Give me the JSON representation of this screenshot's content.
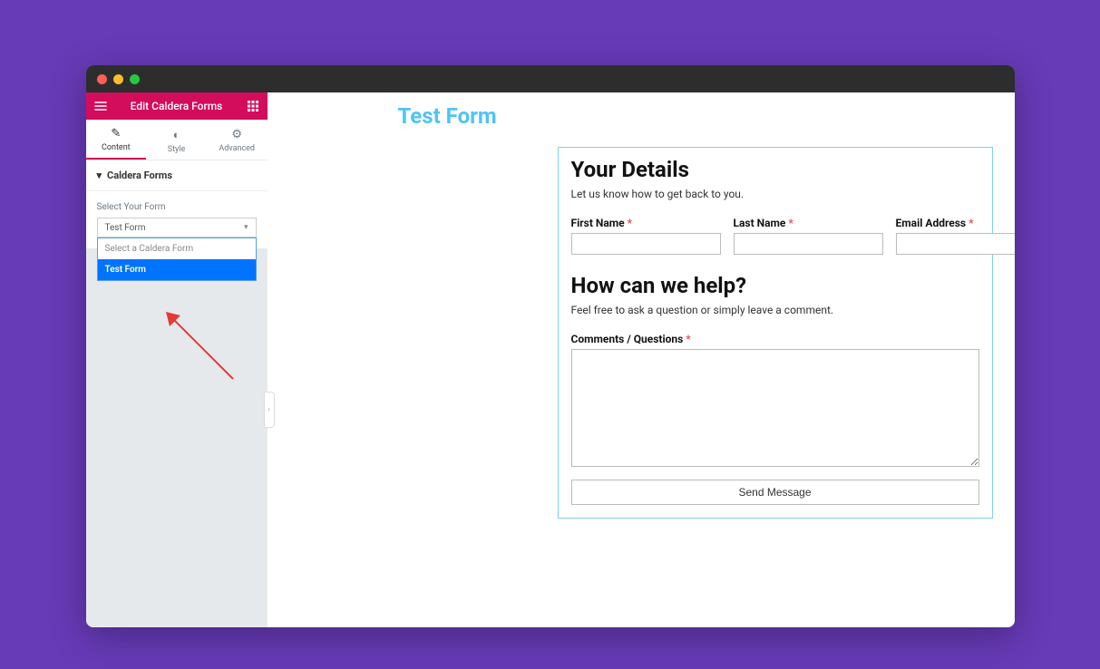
{
  "sidebar": {
    "header_title": "Edit Caldera Forms",
    "tabs": {
      "content": "Content",
      "style": "Style",
      "advanced": "Advanced"
    },
    "section_title": "Caldera Forms",
    "select_label": "Select Your Form",
    "select_current": "Test Form",
    "dropdown": {
      "placeholder": "Select a Caldera Form",
      "option_selected": "Test Form"
    }
  },
  "canvas": {
    "page_title": "Test Form"
  },
  "form": {
    "section1_title": "Your Details",
    "section1_sub": "Let us know how to get back to you.",
    "first_name_label": "First Name",
    "last_name_label": "Last Name",
    "email_label": "Email Address",
    "section2_title": "How can we help?",
    "section2_sub": "Feel free to ask a question or simply leave a comment.",
    "comments_label": "Comments / Questions",
    "required_mark": "*",
    "submit_label": "Send Message"
  }
}
